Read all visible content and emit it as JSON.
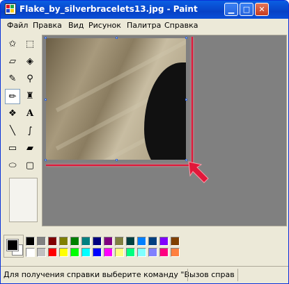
{
  "window": {
    "title": "Flake_by_silverbracelets13.jpg - Paint",
    "controls": [
      "minimize",
      "maximize",
      "close"
    ]
  },
  "menu": {
    "items": [
      "Файл",
      "Правка",
      "Вид",
      "Рисунок",
      "Палитра",
      "Справка"
    ]
  },
  "tools": [
    {
      "name": "free-form-select-icon",
      "glyph": "✩"
    },
    {
      "name": "select-icon",
      "glyph": "⬚"
    },
    {
      "name": "eraser-icon",
      "glyph": "▱"
    },
    {
      "name": "fill-icon",
      "glyph": "◈"
    },
    {
      "name": "pick-color-icon",
      "glyph": "✎"
    },
    {
      "name": "magnifier-icon",
      "glyph": "⚲"
    },
    {
      "name": "pencil-icon",
      "glyph": "✏"
    },
    {
      "name": "brush-icon",
      "glyph": "♜"
    },
    {
      "name": "airbrush-icon",
      "glyph": "❖"
    },
    {
      "name": "text-icon",
      "glyph": "A"
    },
    {
      "name": "line-icon",
      "glyph": "╲"
    },
    {
      "name": "curve-icon",
      "glyph": "∫"
    },
    {
      "name": "rectangle-icon",
      "glyph": "▭"
    },
    {
      "name": "polygon-icon",
      "glyph": "▰"
    },
    {
      "name": "ellipse-icon",
      "glyph": "⬭"
    },
    {
      "name": "rounded-rectangle-icon",
      "glyph": "▢"
    }
  ],
  "active_tool": "pencil-icon",
  "palette": {
    "foreground": "#000000",
    "background": "#ffffff",
    "colors_top": [
      "#000000",
      "#808080",
      "#800000",
      "#808000",
      "#008000",
      "#008080",
      "#000080",
      "#800080",
      "#808040",
      "#004040",
      "#0080ff",
      "#004080",
      "#8000ff",
      "#804000"
    ],
    "colors_bottom": [
      "#ffffff",
      "#c0c0c0",
      "#ff0000",
      "#ffff00",
      "#00ff00",
      "#00ffff",
      "#0000ff",
      "#ff00ff",
      "#ffff80",
      "#00ff80",
      "#80ffff",
      "#8080ff",
      "#ff0080",
      "#ff8040"
    ]
  },
  "colors": {
    "titlebar": "#0842c6",
    "annotation": "#e1183a"
  },
  "status": {
    "text": "Для получения справки выберите команду \"Вызов справ"
  }
}
